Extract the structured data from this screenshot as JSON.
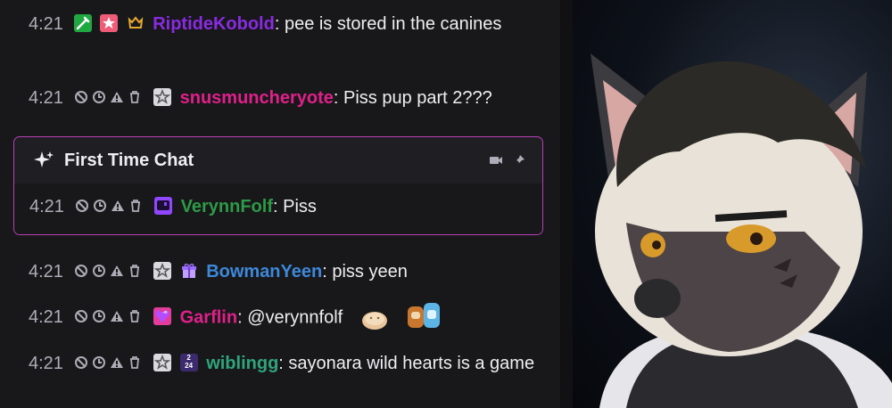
{
  "colors": {
    "chat_bg": "#18181b",
    "timestamp": "#adadb8",
    "first_time_border": "#b83fb8",
    "riptide": "#8a2be2",
    "snus": "#e0208a",
    "verynn": "#2e9a47",
    "bowman": "#3d88d9",
    "garflin": "#e0208a",
    "wiblingg": "#2ea57a"
  },
  "first_time_chat": {
    "title": "First Time Chat",
    "icons": [
      "camera-icon",
      "pin-icon"
    ]
  },
  "messages": [
    {
      "time": "4:21",
      "user": "RiptideKobold",
      "text": ": pee is stored in the canines",
      "badges": [
        "sword-badge",
        "star-badge",
        "crown-badge"
      ],
      "mod_tools": false
    },
    {
      "time": "4:21",
      "user": "snusmuncheryote",
      "text": ": Piss pup part 2???",
      "badges": [
        "star-badge"
      ],
      "mod_tools": true
    },
    {
      "time": "4:21",
      "user": "VerynnFolf",
      "text": ": Piss",
      "badges": [
        "chat-bubble-badge"
      ],
      "mod_tools": true
    },
    {
      "time": "4:21",
      "user": "BowmanYeen",
      "text": ": piss yeen",
      "badges": [
        "star-badge",
        "gift-badge"
      ],
      "mod_tools": true
    },
    {
      "time": "4:21",
      "user": "Garflin",
      "text": ": @verynnfolf",
      "badges": [
        "heart-gem-badge"
      ],
      "mod_tools": true,
      "emotes": [
        "bread-emote",
        "dog-pair-emote"
      ]
    },
    {
      "time": "4:21",
      "user": "wiblingg",
      "text": ": sayonara wild hearts is a game",
      "badges": [
        "star-badge",
        "calendar-24-badge"
      ],
      "mod_tools": true
    }
  ],
  "mod_tool_icons": [
    "ban-icon",
    "timeout-icon",
    "warn-icon",
    "delete-icon"
  ],
  "calendar_badge_text": {
    "top": "2",
    "bottom": "24"
  }
}
